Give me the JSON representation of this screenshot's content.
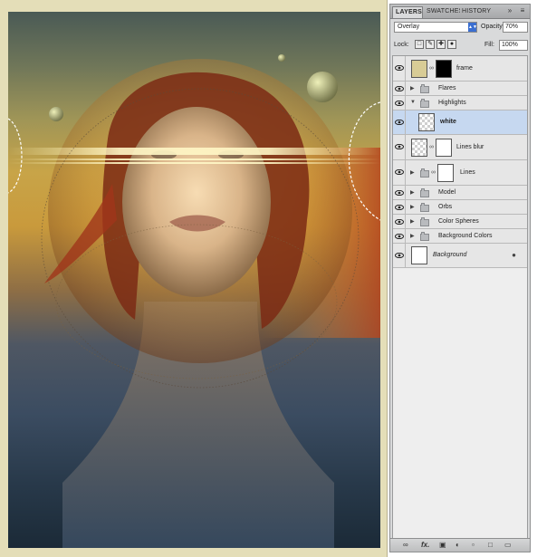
{
  "panel": {
    "tabs": [
      "LAYERS",
      "SWATCHES",
      "HISTORY"
    ],
    "collapse_icon": "double-chevron-icon",
    "menu_icon": "panel-menu-icon",
    "blend_mode": "Overlay",
    "opacity_label": "Opacity:",
    "opacity_value": "70%",
    "lock_label": "Lock:",
    "fill_label": "Fill:",
    "fill_value": "100%"
  },
  "layers": [
    {
      "name": "frame",
      "type": "layer-mask-black",
      "thumb_color": "#d8cc96",
      "mask_color": "#000000"
    },
    {
      "name": "Flares",
      "type": "group",
      "expanded": false
    },
    {
      "name": "Highlights",
      "type": "group",
      "expanded": true
    },
    {
      "name": "white",
      "type": "layer-transparent",
      "selected": true
    },
    {
      "name": "Lines blur",
      "type": "layer-mask"
    },
    {
      "name": "Lines",
      "type": "group-mask",
      "expanded": false
    },
    {
      "name": "Model",
      "type": "group",
      "expanded": false
    },
    {
      "name": "Orbs",
      "type": "group",
      "expanded": false
    },
    {
      "name": "Color Spheres",
      "type": "group",
      "expanded": false
    },
    {
      "name": "Background Colors",
      "type": "group",
      "expanded": false
    },
    {
      "name": "Background",
      "type": "background",
      "locked": true
    }
  ],
  "bottom_icons": [
    "link-icon",
    "fx-icon",
    "mask-icon",
    "adjustment-icon",
    "new-group-icon",
    "new-layer-icon",
    "trash-icon"
  ],
  "bottom_glyphs": {
    "fx": "fx."
  }
}
